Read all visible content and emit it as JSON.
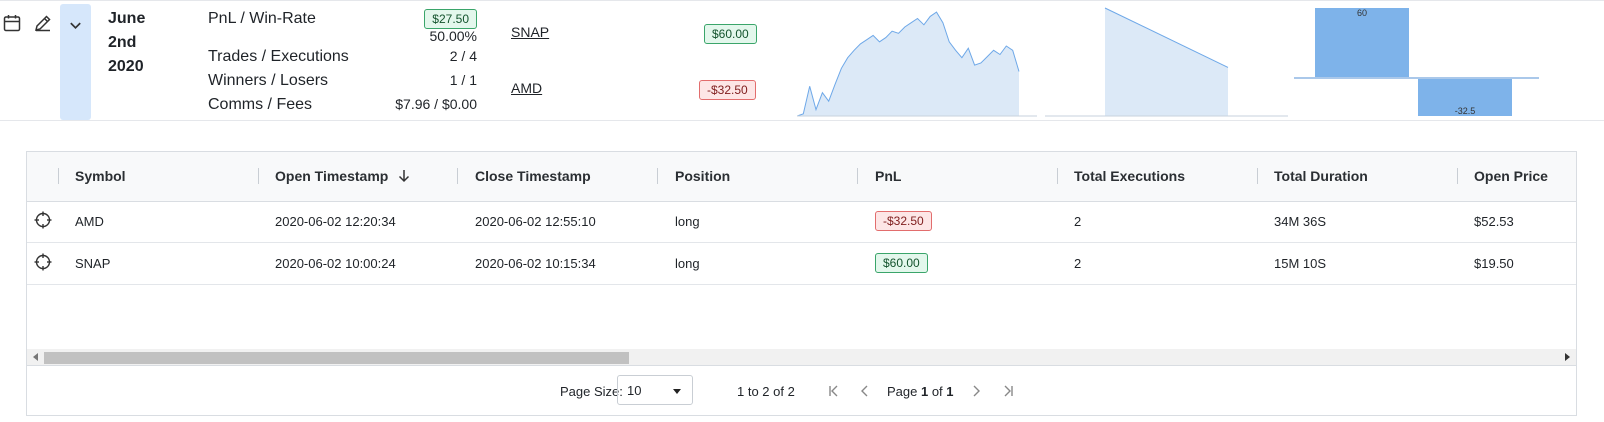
{
  "day": {
    "date_line1": "June",
    "date_line2": "2nd",
    "date_line3": "2020",
    "pnl_label": "PnL / Win-Rate",
    "pnl_value": "$27.50",
    "win_rate": "50.00%",
    "trades_label": "Trades / Executions",
    "trades_value": "2 / 4",
    "winners_label": "Winners / Losers",
    "winners_value": "1 / 1",
    "comms_label": "Comms / Fees",
    "comms_value": "$7.96 / $0.00",
    "symbols": [
      {
        "symbol": "SNAP",
        "pnl": "$60.00",
        "status": "positive"
      },
      {
        "symbol": "AMD",
        "pnl": "-$32.50",
        "status": "negative"
      }
    ],
    "bar_chart_labels": {
      "win": "60",
      "loss": "-32.5"
    }
  },
  "colors": {
    "chart_fill": "#dce9f7",
    "chart_line": "#6ea8e8",
    "bar_fill": "#7eb3ea"
  },
  "table": {
    "columns": [
      "Symbol",
      "Open Timestamp",
      "Close Timestamp",
      "Position",
      "PnL",
      "Total Executions",
      "Total Duration",
      "Open Price"
    ],
    "sort_icon": "arrow-down-icon",
    "rows": [
      {
        "symbol": "AMD",
        "open": "2020-06-02 12:20:34",
        "close": "2020-06-02 12:55:10",
        "position": "long",
        "pnl": "-$32.50",
        "pnl_status": "negative",
        "executions": "2",
        "duration": "34M 36S",
        "open_price": "$52.53"
      },
      {
        "symbol": "SNAP",
        "open": "2020-06-02 10:00:24",
        "close": "2020-06-02 10:15:34",
        "position": "long",
        "pnl": "$60.00",
        "pnl_status": "positive",
        "executions": "2",
        "duration": "15M 10S",
        "open_price": "$19.50"
      }
    ]
  },
  "pagination": {
    "page_size_label": "Page Size:",
    "page_size_value": "10",
    "range_text": "1 to 2 of 2",
    "page_prefix": "Page ",
    "page_current": "1",
    "page_of": " of ",
    "page_total": "1"
  },
  "chart_data": [
    {
      "type": "area",
      "title": "",
      "y": [
        0,
        2,
        28,
        6,
        22,
        14,
        30,
        45,
        55,
        62,
        68,
        72,
        76,
        70,
        74,
        80,
        78,
        84,
        88,
        92,
        86,
        94,
        98,
        88,
        70,
        62,
        55,
        64,
        48,
        50,
        56,
        62,
        58,
        66,
        62,
        42
      ]
    },
    {
      "type": "area",
      "title": "",
      "x": [
        0,
        1
      ],
      "y": [
        100,
        45
      ]
    },
    {
      "type": "bar",
      "title": "",
      "categories": [
        "SNAP",
        "AMD"
      ],
      "values": [
        60,
        -32.5
      ],
      "ylim": [
        -32.5,
        60
      ]
    }
  ]
}
